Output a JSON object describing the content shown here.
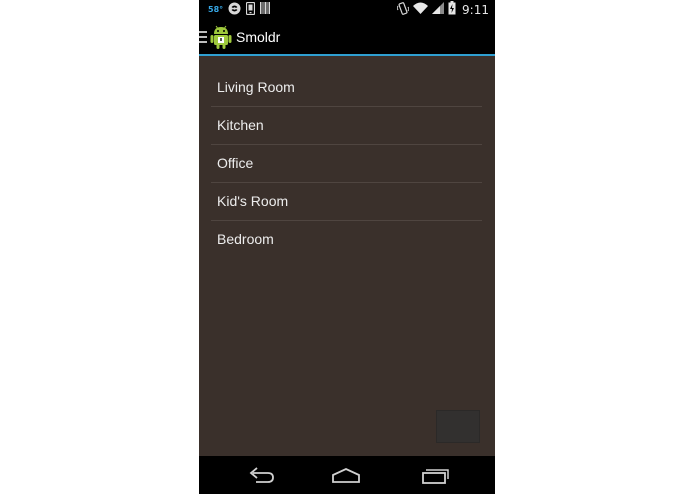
{
  "status_bar": {
    "temperature": "58°",
    "time": "9:11",
    "icons": [
      "weather-icon",
      "sync-icon",
      "phone-icon",
      "barcode-icon",
      "vibrate-icon",
      "wifi-icon",
      "cell-signal-icon",
      "battery-icon"
    ]
  },
  "action_bar": {
    "title": "Smoldr",
    "icons": [
      "drawer-toggle-icon",
      "android-app-icon"
    ],
    "accent_color": "#2f9fd1"
  },
  "rooms": [
    {
      "label": "Living Room"
    },
    {
      "label": "Kitchen"
    },
    {
      "label": "Office"
    },
    {
      "label": "Kid's Room"
    },
    {
      "label": "Bedroom"
    }
  ],
  "nav_bar": {
    "icons": [
      "back-icon",
      "home-icon",
      "recents-icon"
    ]
  },
  "colors": {
    "background": "#3a302b",
    "bars": "#000000",
    "text": "#ededed",
    "divider": "#4f4540"
  }
}
